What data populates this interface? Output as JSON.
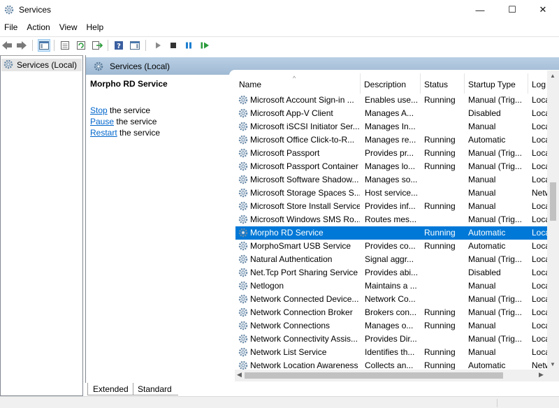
{
  "window": {
    "title": "Services",
    "minimize": "—",
    "maximize": "☐",
    "close": "✕"
  },
  "menu": [
    "File",
    "Action",
    "View",
    "Help"
  ],
  "toolbar": {
    "icons": [
      "back-arrow-icon",
      "forward-arrow-icon",
      "show-hide-console-tree-icon",
      "properties-icon",
      "refresh-icon",
      "export-list-icon",
      "help-icon",
      "show-hide-action-pane-icon",
      "start-service-icon",
      "stop-service-icon",
      "pause-service-icon",
      "resume-service-icon"
    ]
  },
  "tree": {
    "root_label": "Services (Local)"
  },
  "header": {
    "label": "Services (Local)"
  },
  "detail": {
    "service_name": "Morpho RD Service",
    "actions": [
      {
        "link": "Stop",
        "rest": " the service"
      },
      {
        "link": "Pause",
        "rest": " the service"
      },
      {
        "link": "Restart",
        "rest": " the service"
      }
    ]
  },
  "columns": {
    "name": "Name",
    "description": "Description",
    "status": "Status",
    "startup": "Startup Type",
    "log_on": "Log"
  },
  "services": [
    {
      "name": "Microsoft Account Sign-in ...",
      "desc": "Enables use...",
      "status": "Running",
      "startup": "Manual (Trig...",
      "log": "Loca"
    },
    {
      "name": "Microsoft App-V Client",
      "desc": "Manages A...",
      "status": "",
      "startup": "Disabled",
      "log": "Loca"
    },
    {
      "name": "Microsoft iSCSI Initiator Ser...",
      "desc": "Manages In...",
      "status": "",
      "startup": "Manual",
      "log": "Loca"
    },
    {
      "name": "Microsoft Office Click-to-R...",
      "desc": "Manages re...",
      "status": "Running",
      "startup": "Automatic",
      "log": "Loca"
    },
    {
      "name": "Microsoft Passport",
      "desc": "Provides pr...",
      "status": "Running",
      "startup": "Manual (Trig...",
      "log": "Loca"
    },
    {
      "name": "Microsoft Passport Container",
      "desc": "Manages lo...",
      "status": "Running",
      "startup": "Manual (Trig...",
      "log": "Loca"
    },
    {
      "name": "Microsoft Software Shadow...",
      "desc": "Manages so...",
      "status": "",
      "startup": "Manual",
      "log": "Loca"
    },
    {
      "name": "Microsoft Storage Spaces S...",
      "desc": "Host service...",
      "status": "",
      "startup": "Manual",
      "log": "Netw"
    },
    {
      "name": "Microsoft Store Install Service",
      "desc": "Provides inf...",
      "status": "Running",
      "startup": "Manual",
      "log": "Loca"
    },
    {
      "name": "Microsoft Windows SMS Ro...",
      "desc": "Routes mes...",
      "status": "",
      "startup": "Manual (Trig...",
      "log": "Loca"
    },
    {
      "name": "Morpho RD Service",
      "desc": "",
      "status": "Running",
      "startup": "Automatic",
      "log": "Loca",
      "selected": true
    },
    {
      "name": "MorphoSmart USB Service",
      "desc": "Provides co...",
      "status": "Running",
      "startup": "Automatic",
      "log": "Loca"
    },
    {
      "name": "Natural Authentication",
      "desc": "Signal aggr...",
      "status": "",
      "startup": "Manual (Trig...",
      "log": "Loca"
    },
    {
      "name": "Net.Tcp Port Sharing Service",
      "desc": "Provides abi...",
      "status": "",
      "startup": "Disabled",
      "log": "Loca"
    },
    {
      "name": "Netlogon",
      "desc": "Maintains a ...",
      "status": "",
      "startup": "Manual",
      "log": "Loca"
    },
    {
      "name": "Network Connected Device...",
      "desc": "Network Co...",
      "status": "",
      "startup": "Manual (Trig...",
      "log": "Loca"
    },
    {
      "name": "Network Connection Broker",
      "desc": "Brokers con...",
      "status": "Running",
      "startup": "Manual (Trig...",
      "log": "Loca"
    },
    {
      "name": "Network Connections",
      "desc": "Manages o...",
      "status": "Running",
      "startup": "Manual",
      "log": "Loca"
    },
    {
      "name": "Network Connectivity Assis...",
      "desc": "Provides Dir...",
      "status": "",
      "startup": "Manual (Trig...",
      "log": "Loca"
    },
    {
      "name": "Network List Service",
      "desc": "Identifies th...",
      "status": "Running",
      "startup": "Manual",
      "log": "Loca"
    },
    {
      "name": "Network Location Awareness",
      "desc": "Collects an...",
      "status": "Running",
      "startup": "Automatic",
      "log": "Netw"
    }
  ],
  "tabs": {
    "extended": "Extended",
    "standard": "Standard"
  },
  "colors": {
    "selection": "#0078d7",
    "header_gradient_top": "#b9cfe4",
    "header_gradient_bottom": "#9fb9d3",
    "link": "#0066cc"
  }
}
